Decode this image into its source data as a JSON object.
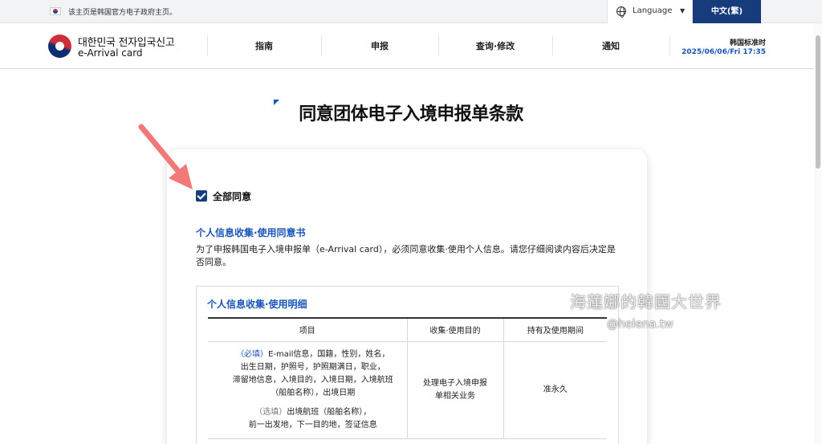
{
  "topbar": {
    "notice": "该主页是韩国官方电子政府主页。",
    "language_label": "Language",
    "language_caret": "▼",
    "current_language": "中文(繁)"
  },
  "header": {
    "brand_ko": "대한민국 전자입국신고",
    "brand_en": "e-Arrival card",
    "nav": [
      "指南",
      "申报",
      "查询·修改",
      "通知"
    ],
    "clock_label": "韩国标准时",
    "clock_value": "2025/06/06/Fri 17:35"
  },
  "page": {
    "title": "同意团体电子入境申报单条款"
  },
  "consent": {
    "agree_all_label": "全部同意",
    "agree_all_checked": true,
    "section_title": "个人信息收集·使用同意书",
    "section_desc": "为了申报韩国电子入境申报单（e-Arrival card），必须同意收集·使用个人信息。请您仔细阅读内容后决定是否同意。",
    "detail_title": "个人信息收集·使用明细",
    "table_headers": [
      "项目",
      "收集·使用目的",
      "持有及使用期间"
    ],
    "required_tag": "（必填）",
    "required_items": [
      "E-mail信息，国籍，性别，姓名，",
      "出生日期，护照号，护照期满日，职业，",
      "滞留地信息，入境目的，入境日期，入境航班",
      "（船舶名称），出境日期"
    ],
    "optional_tag": "（选填）",
    "optional_items": [
      "出境航班（船舶名称），",
      "前一出发地，下一目的地，签证信息"
    ],
    "purpose": [
      "处理电子入境申报",
      "单相关业务"
    ],
    "period": "准永久"
  },
  "watermark": {
    "line1": "海蓮娜的韓國大世界",
    "line2": "@helena.tw"
  },
  "colors": {
    "primary": "#163c7b",
    "accent_blue": "#1a56b8",
    "annotation_arrow": "#f07a7a"
  }
}
